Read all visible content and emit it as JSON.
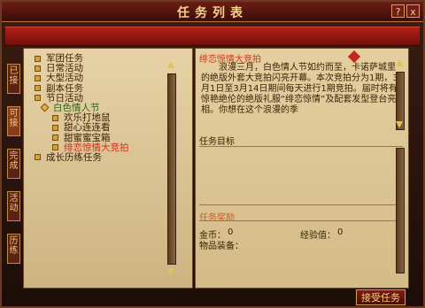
{
  "window": {
    "title": "任务列表",
    "help_button": "?",
    "close_button": "x"
  },
  "side_tabs": [
    {
      "label": "已接"
    },
    {
      "label": "可接",
      "active": true
    },
    {
      "label": "完成"
    },
    {
      "label": "活动"
    },
    {
      "label": "历练"
    }
  ],
  "quest_tree": [
    {
      "label": "军团任务",
      "level": 0
    },
    {
      "label": "日常活动",
      "level": 0
    },
    {
      "label": "大型活动",
      "level": 0
    },
    {
      "label": "副本任务",
      "level": 0
    },
    {
      "label": "节日活动",
      "level": 0
    },
    {
      "label": "白色情人节",
      "level": 1
    },
    {
      "label": "欢乐打地鼠",
      "level": 2
    },
    {
      "label": "甜心连连看",
      "level": 2
    },
    {
      "label": "甜蜜蜜宝箱",
      "level": 2
    },
    {
      "label": "绯恋惊情大竞拍",
      "level": 2,
      "selected": true
    },
    {
      "label": "成长历练任务",
      "level": 0
    }
  ],
  "detail": {
    "quest_name": "绯恋惊情大竞拍",
    "description": "浪漫三月，白色情人节如约而至，卡诺萨城里的绝版外套大竞拍闪亮开幕。本次竞拍分为1期，3月1日至3月14日期间每天进行1期竞拍。届时将有惊艳绝伦的绝版礼服“绯恋惊情”及配套发型登台亮相。你想在这个浪漫的季",
    "objective_label": "任务目标",
    "reward_label": "任务奖励",
    "gold_label": "金币：",
    "gold_value": "0",
    "exp_label": "经验值：",
    "exp_value": "0",
    "items_label": "物品装备："
  },
  "accept_button": "接受任务"
}
